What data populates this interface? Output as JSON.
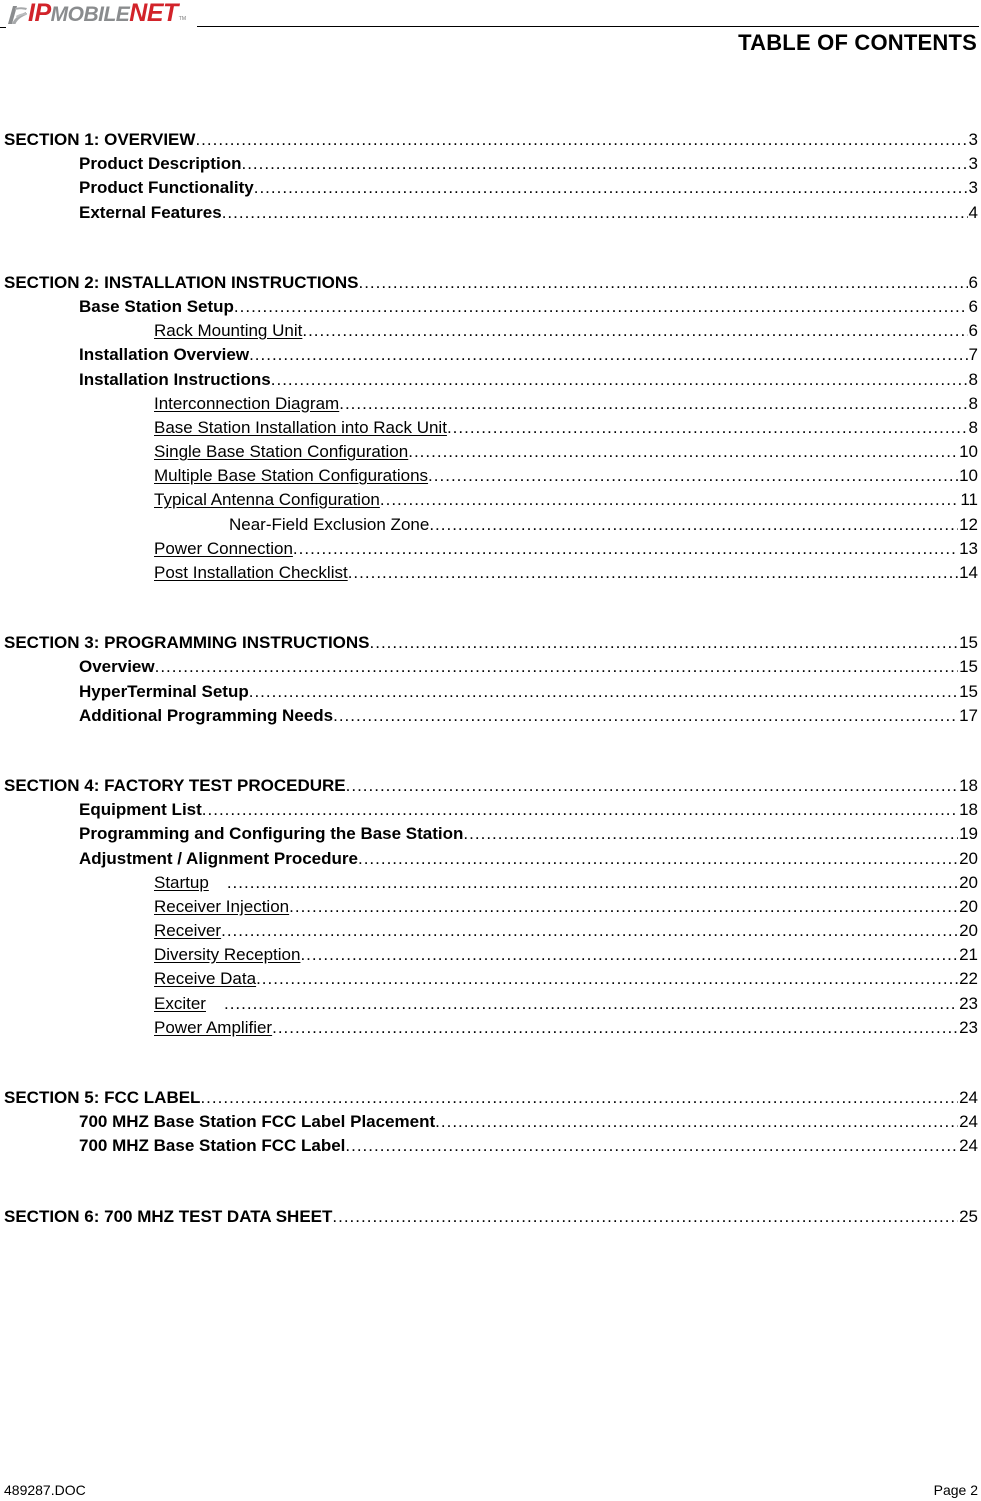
{
  "header": {
    "logo": {
      "part1": "IP",
      "part2": "MOBILE",
      "part3": "NET",
      "tm": "TM"
    },
    "title": "TABLE OF CONTENTS"
  },
  "toc": [
    {
      "level": 0,
      "label": "SECTION 1:  OVERVIEW",
      "page": "3"
    },
    {
      "level": 1,
      "label": "Product Description",
      "page": "3"
    },
    {
      "level": 1,
      "label": "Product Functionality ",
      "page": "3"
    },
    {
      "level": 1,
      "label": "External Features",
      "page": "4"
    },
    {
      "level": 0,
      "label": "SECTION 2:  INSTALLATION INSTRUCTIONS ",
      "page": "6",
      "gap_before": true
    },
    {
      "level": 1,
      "label": "Base Station Setup ",
      "page": "6"
    },
    {
      "level": 2,
      "label": "Rack Mounting Unit",
      "page": "6"
    },
    {
      "level": 1,
      "label": "Installation Overview ",
      "page": "7"
    },
    {
      "level": 1,
      "label": "Installation Instructions",
      "page": "8"
    },
    {
      "level": 2,
      "label": "Interconnection Diagram",
      "page": "8"
    },
    {
      "level": 2,
      "label": "Base Station Installation into Rack Unit",
      "page": "8"
    },
    {
      "level": 2,
      "label": "Single Base Station Configuration",
      "page": "10"
    },
    {
      "level": 2,
      "label": "Multiple Base Station Configurations",
      "page": "10"
    },
    {
      "level": 2,
      "label": "Typical Antenna Configuration",
      "page": "11"
    },
    {
      "level": 3,
      "label": "Near-Field Exclusion Zone",
      "page": "12"
    },
    {
      "level": 2,
      "label": "Power Connection",
      "page": "13"
    },
    {
      "level": 2,
      "label": "Post Installation Checklist",
      "page": "14"
    },
    {
      "level": 0,
      "label": "SECTION 3:  PROGRAMMING INSTRUCTIONS",
      "page": "15",
      "gap_before": true
    },
    {
      "level": 1,
      "label": "Overview ",
      "page": "15"
    },
    {
      "level": 1,
      "label": "HyperTerminal Setup",
      "page": "15"
    },
    {
      "level": 1,
      "label": "Additional Programming Needs ",
      "page": "17"
    },
    {
      "level": 0,
      "label": "SECTION 4:  FACTORY TEST PROCEDURE ",
      "page": "18",
      "gap_before": true
    },
    {
      "level": 1,
      "label": "Equipment List ",
      "page": "18"
    },
    {
      "level": 1,
      "label": "Programming and Configuring the Base Station ",
      "page": "19"
    },
    {
      "level": 1,
      "label": "Adjustment / Alignment Procedure",
      "page": "20"
    },
    {
      "level": 2,
      "label": "Startup",
      "page": "20",
      "tab_after": true
    },
    {
      "level": 2,
      "label": "Receiver Injection",
      "page": "20"
    },
    {
      "level": 2,
      "label": "Receiver",
      "page": "20"
    },
    {
      "level": 2,
      "label": "Diversity Reception",
      "page": "21"
    },
    {
      "level": 2,
      "label": "Receive Data",
      "page": "22"
    },
    {
      "level": 2,
      "label": "Exciter",
      "page": "23",
      "tab_after": true
    },
    {
      "level": 2,
      "label": "Power Amplifier",
      "page": "23"
    },
    {
      "level": 0,
      "label": "SECTION 5:  FCC LABEL",
      "page": "24",
      "gap_before": true
    },
    {
      "level": 1,
      "label": "700 MHZ Base Station FCC Label Placement ",
      "page": "24"
    },
    {
      "level": 1,
      "label": "700 MHZ Base Station FCC Label",
      "page": "24"
    },
    {
      "level": 0,
      "label": "SECTION 6: 700 MHZ TEST DATA SHEET",
      "page": "25",
      "gap_before": true
    }
  ],
  "footer": {
    "doc_name": "489287.DOC",
    "page_label": "Page 2"
  }
}
